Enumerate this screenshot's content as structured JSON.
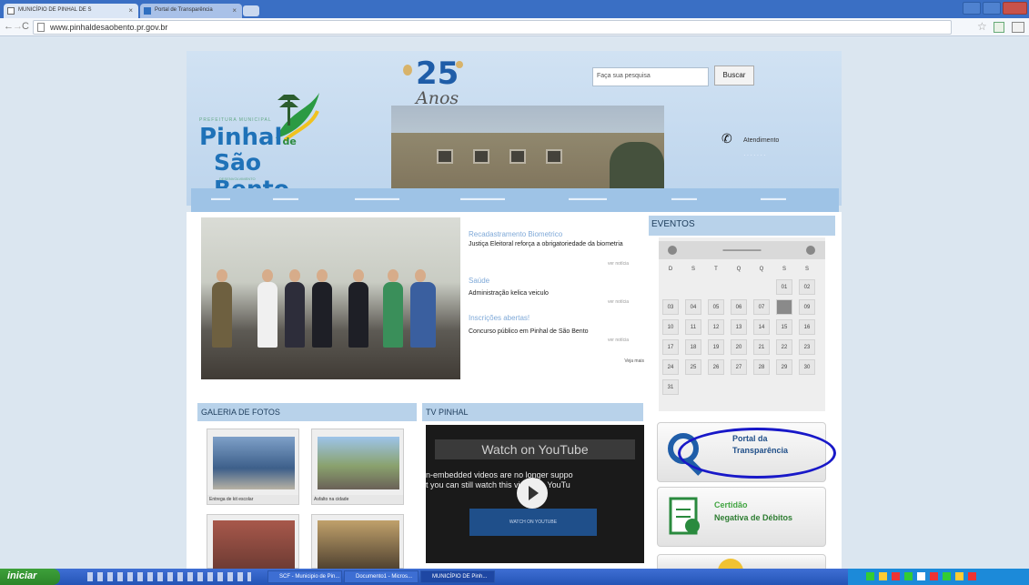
{
  "browser": {
    "tabs": [
      {
        "label": "MUNICÍPIO DE PINHAL DE S"
      },
      {
        "label": "Portal de Transparência"
      }
    ],
    "url": "www.pinhaldesaobento.pr.gov.br"
  },
  "header": {
    "logo_line1": "Pinhal",
    "logo_de": "de",
    "logo_line2": "São Bento",
    "anniversary_number": "25",
    "anniversary_word": "Anos",
    "search_placeholder": "Faça sua pesquisa",
    "search_button": "Buscar",
    "contact_label": "Atendimento"
  },
  "news": [
    {
      "title": "Recadastramento Biometrico",
      "text": "Justiça Eleitoral reforça a obrigatoriedade da biometria",
      "more": "ver notícia"
    },
    {
      "title": "Saúde",
      "text": "Administração kelica veiculo",
      "more": "ver notícia"
    },
    {
      "title": "Inscrições abertas!",
      "text": "Concurso público em Pinhal de São Bento",
      "more": "ver notícia"
    }
  ],
  "news_all": "Veja mais",
  "events": {
    "heading": "EVENTOS",
    "weekdays": [
      "D",
      "S",
      "T",
      "Q",
      "Q",
      "S",
      "S"
    ],
    "days": [
      [
        "",
        "",
        "",
        "",
        "",
        "01",
        "02"
      ],
      [
        "03",
        "04",
        "05",
        "06",
        "07",
        "",
        "09"
      ],
      [
        "10",
        "11",
        "12",
        "13",
        "14",
        "15",
        "16"
      ],
      [
        "17",
        "18",
        "19",
        "20",
        "21",
        "22",
        "23"
      ],
      [
        "24",
        "25",
        "26",
        "27",
        "28",
        "29",
        "30"
      ],
      [
        "31",
        "",
        "",
        "",
        "",
        "",
        ""
      ]
    ]
  },
  "gallery": {
    "heading": "GALERIA DE FOTOS",
    "items": [
      {
        "caption": "Entrega de kit escolar"
      },
      {
        "caption": "Asfalto na cidade"
      }
    ]
  },
  "tv": {
    "heading": "TV PINHAL",
    "brand": "Watch on YouTube",
    "message_line1": "n-embedded videos are no longer suppo",
    "message_line2": "t you can still watch this video on YouTu",
    "watch_button": "WATCH ON YOUTUBE"
  },
  "banners": {
    "portal_line1": "Portal da",
    "portal_line2": "Transparência",
    "certidao_line1": "Certidão",
    "certidao_line2": "Negativa de Débitos"
  },
  "taskbar": {
    "start": "iniciar",
    "items": [
      {
        "label": "SCF - Municipio de Pin..."
      },
      {
        "label": "Documento1 - Micros..."
      },
      {
        "label": "MUNICÍPIO DE Pinh..."
      }
    ]
  }
}
